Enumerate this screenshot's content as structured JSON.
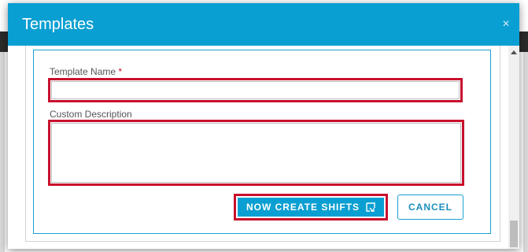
{
  "dialog": {
    "title": "Templates",
    "close_icon": "close-icon"
  },
  "form": {
    "template_name_label": "Template Name",
    "required_marker": "*",
    "template_name_value": "",
    "custom_description_label": "Custom Description",
    "custom_description_value": ""
  },
  "actions": {
    "create_label": "NOW CREATE SHIFTS",
    "create_icon": "external-link-icon",
    "cancel_label": "CANCEL"
  },
  "colors": {
    "header": "#0a9fd2",
    "highlight": "#c8102e",
    "primary_button": "#0a9fd2"
  }
}
